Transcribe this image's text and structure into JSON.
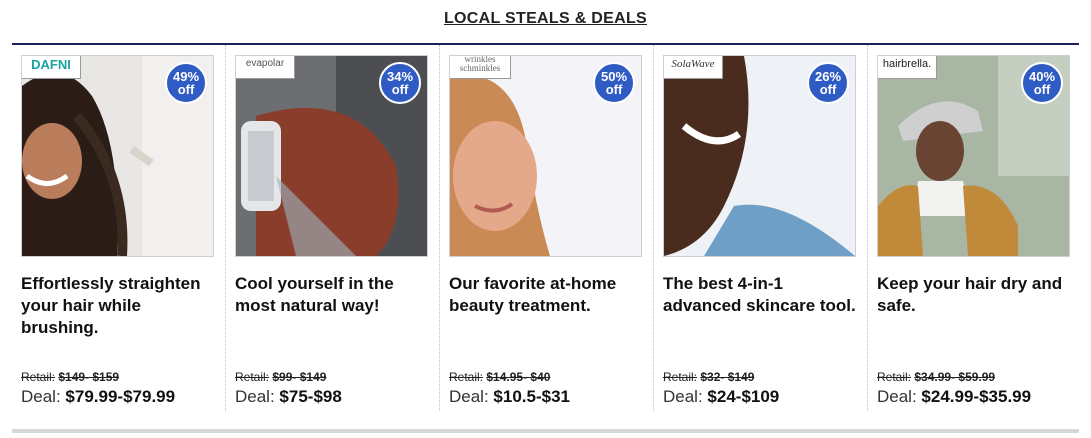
{
  "section": {
    "title": "LOCAL STEALS & DEALS"
  },
  "cards": [
    {
      "brand": "DAFNI",
      "discount_pct": "49%",
      "discount_off": "off",
      "headline": "Effortlessly straighten your hair while brushing.",
      "retail_label": "Retail:",
      "retail_price": "$149- $159",
      "deal_label": "Deal:",
      "deal_price": "$79.99-$79.99"
    },
    {
      "brand": "evapolar",
      "discount_pct": "34%",
      "discount_off": "off",
      "headline": "Cool yourself in the most natural way!",
      "retail_label": "Retail:",
      "retail_price": "$99- $149",
      "deal_label": "Deal:",
      "deal_price": "$75-$98"
    },
    {
      "brand": "wrinkles schminkles",
      "discount_pct": "50%",
      "discount_off": "off",
      "headline": "Our favorite at-home beauty treatment.",
      "retail_label": "Retail:",
      "retail_price": "$14.95- $40",
      "deal_label": "Deal:",
      "deal_price": "$10.5-$31"
    },
    {
      "brand": "SolaWave",
      "discount_pct": "26%",
      "discount_off": "off",
      "headline": "The best 4-in-1 advanced skincare tool.",
      "retail_label": "Retail:",
      "retail_price": "$32- $149",
      "deal_label": "Deal:",
      "deal_price": "$24-$109"
    },
    {
      "brand": "hairbrella.",
      "discount_pct": "40%",
      "discount_off": "off",
      "headline": "Keep your hair dry and safe.",
      "retail_label": "Retail:",
      "retail_price": "$34.99- $59.99",
      "deal_label": "Deal:",
      "deal_price": "$24.99-$35.99"
    }
  ],
  "colors": {
    "badge": "#2f5cc4",
    "rule": "#1d1f5a"
  }
}
